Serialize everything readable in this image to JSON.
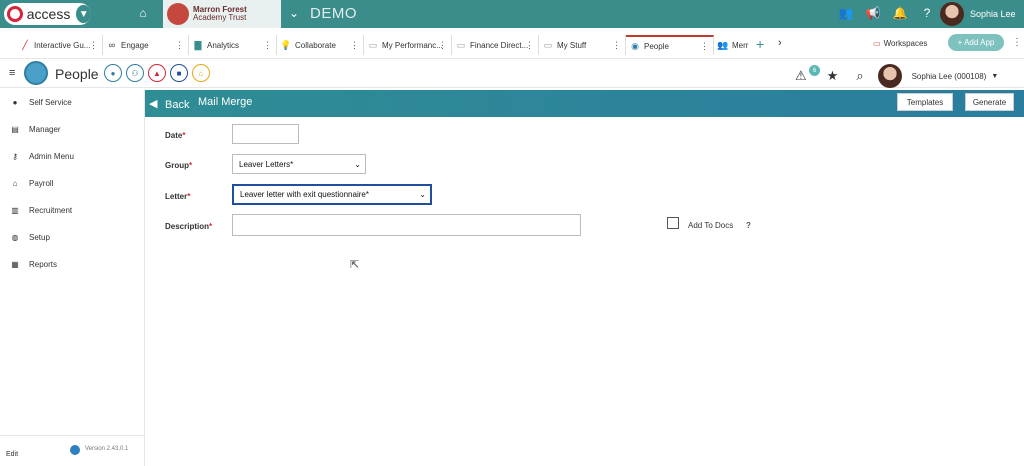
{
  "topbar": {
    "app_name": "access",
    "org_line1": "Marron Forest",
    "org_line2": "Academy Trust",
    "environment": "DEMO",
    "user_name": "Sophia Lee",
    "icons": [
      "people-icon",
      "megaphone-icon",
      "bell-icon",
      "help-icon"
    ]
  },
  "tabs": [
    {
      "label": "Interactive Gu...",
      "icon": "chart-icon"
    },
    {
      "label": "Engage",
      "icon": "infinity-icon"
    },
    {
      "label": "Analytics",
      "icon": "bar-chart-icon"
    },
    {
      "label": "Collaborate",
      "icon": "bulb-icon"
    },
    {
      "label": "My Performanc...",
      "icon": "folder-icon"
    },
    {
      "label": "Finance Direct...",
      "icon": "folder-icon"
    },
    {
      "label": "My Stuff",
      "icon": "folder-icon"
    },
    {
      "label": "People",
      "icon": "people-icon",
      "active": true
    },
    {
      "label": "Merr",
      "icon": "people-icon"
    }
  ],
  "tabbar": {
    "workspaces_label": "Workspaces",
    "add_app_label": "+ Add App"
  },
  "module": {
    "title": "People",
    "alert_count": "6",
    "user_label": "Sophia Lee (000108)"
  },
  "sidebar": {
    "items": [
      {
        "label": "Self Service",
        "icon": "person-icon"
      },
      {
        "label": "Manager",
        "icon": "document-icon"
      },
      {
        "label": "Admin Menu",
        "icon": "key-icon"
      },
      {
        "label": "Payroll",
        "icon": "house-icon"
      },
      {
        "label": "Recruitment",
        "icon": "building-icon"
      },
      {
        "label": "Setup",
        "icon": "globe-icon"
      },
      {
        "label": "Reports",
        "icon": "report-icon"
      }
    ],
    "edit_label": "Edit",
    "version": "Version 2.43.0.1"
  },
  "mail_merge": {
    "back_label": "Back",
    "title": "Mail Merge",
    "templates_button": "Templates",
    "generate_button": "Generate",
    "date_label": "Date",
    "date_value": "",
    "group_label": "Group",
    "group_value": "Leaver Letters*",
    "letter_label": "Letter",
    "letter_value": "Leaver letter with exit questionnaire*",
    "description_label": "Description",
    "description_value": "",
    "add_to_docs_label": "Add To Docs",
    "add_to_docs_checked": false,
    "help_glyph": "?"
  },
  "colors": {
    "topbar": "#3a8d8a",
    "banner": "#2f8d95",
    "required": "#d6263a"
  }
}
